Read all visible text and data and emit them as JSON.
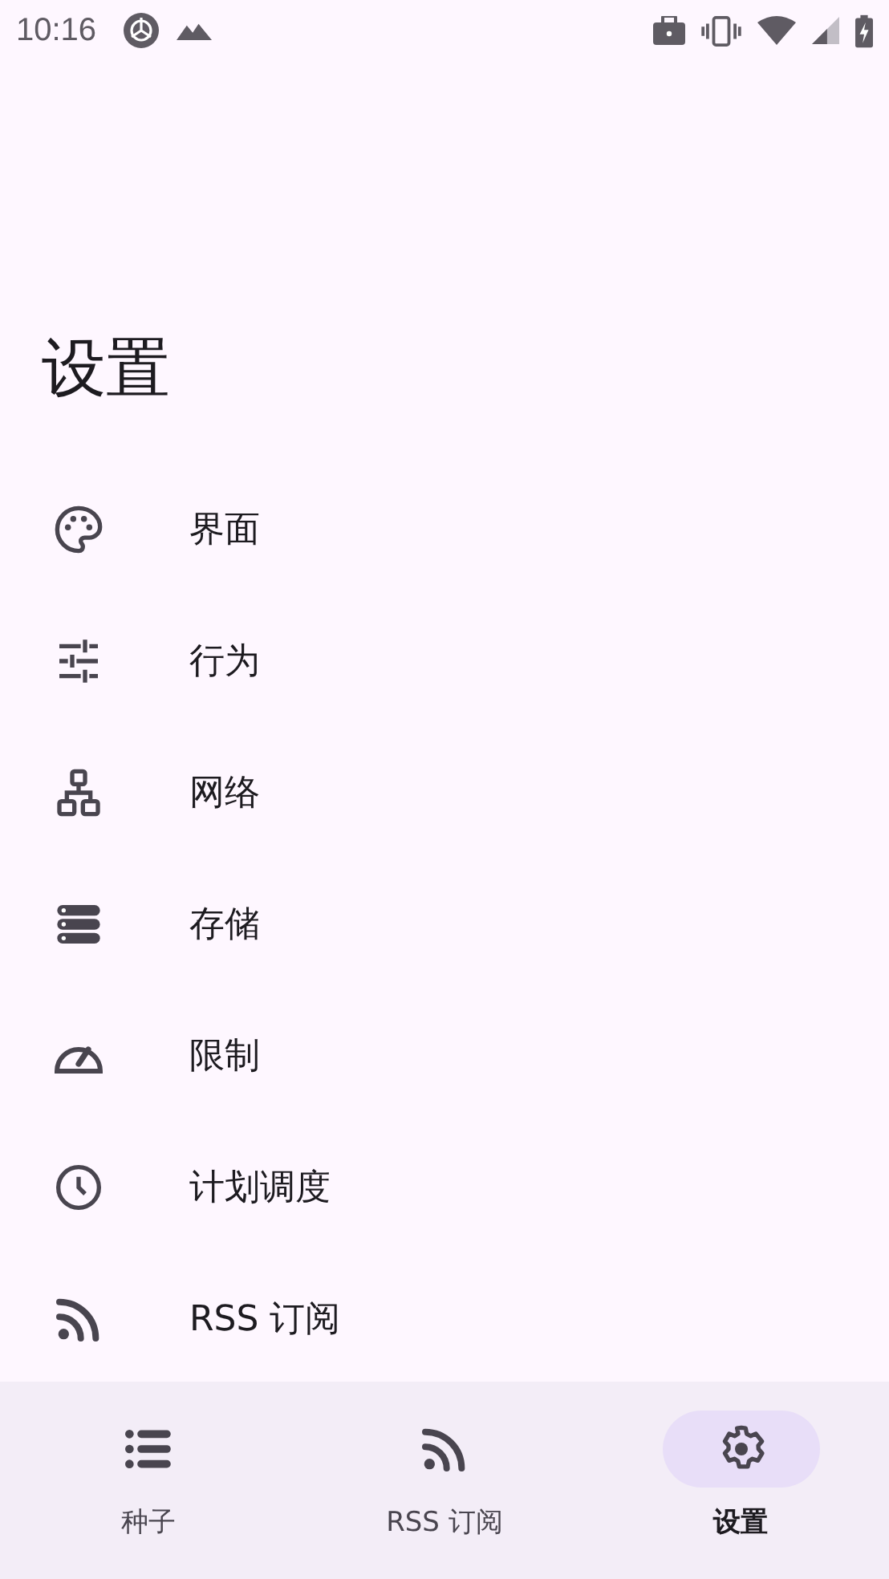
{
  "status_bar": {
    "time": "10:16"
  },
  "title": "设置",
  "settings": [
    {
      "label": "界面",
      "kind": "palette"
    },
    {
      "label": "行为",
      "kind": "tune"
    },
    {
      "label": "网络",
      "kind": "network"
    },
    {
      "label": "存储",
      "kind": "storage"
    },
    {
      "label": "限制",
      "kind": "speed"
    },
    {
      "label": "计划调度",
      "kind": "clock"
    },
    {
      "label": "RSS 订阅",
      "kind": "rss"
    }
  ],
  "nav": [
    {
      "label": "种子",
      "kind": "list",
      "selected": false
    },
    {
      "label": "RSS 订阅",
      "kind": "rss",
      "selected": false
    },
    {
      "label": "设置",
      "kind": "gear",
      "selected": true
    }
  ]
}
